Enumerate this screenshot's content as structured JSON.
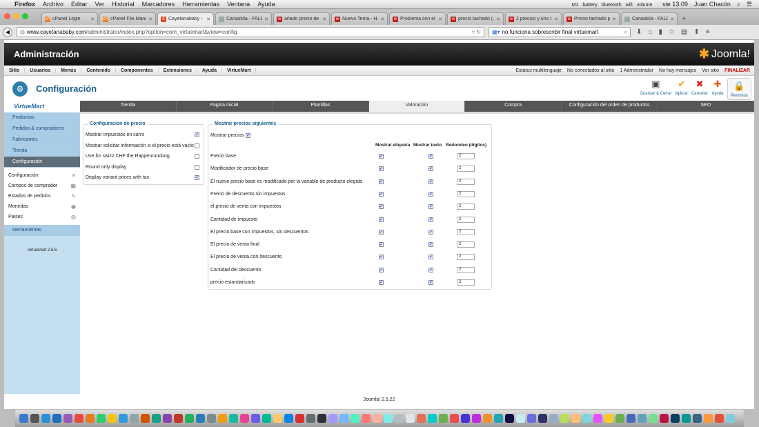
{
  "menubar": {
    "app": "Firefox",
    "items": [
      "Archivo",
      "Editar",
      "Ver",
      "Historial",
      "Marcadores",
      "Herramientas",
      "Ventana",
      "Ayuda"
    ],
    "clock": "vie 13:09",
    "user": "Juan Chacón",
    "status_icons": [
      "M1",
      "battery",
      "bluetooth",
      "wifi",
      "volume"
    ]
  },
  "tabs": [
    {
      "label": "cPanel Login",
      "favcolor": "#f08020",
      "fav": "cP",
      "active": false
    },
    {
      "label": "cPanel File Mana...",
      "favcolor": "#f08020",
      "fav": "cP",
      "active": false
    },
    {
      "label": "Cayetanababy - ...",
      "favcolor": "#e04a2a",
      "fav": "X",
      "active": true
    },
    {
      "label": "Canastilla - FALD...",
      "favcolor": "#9aa",
      "fav": "",
      "active": false
    },
    {
      "label": "añadir precio de ...",
      "favcolor": "#c21d1d",
      "fav": "w",
      "active": false
    },
    {
      "label": "Nuevo Tema - H...",
      "favcolor": "#c21d1d",
      "fav": "w",
      "active": false
    },
    {
      "label": "Problema con el ...",
      "favcolor": "#c21d1d",
      "fav": "w",
      "active": false
    },
    {
      "label": "precio tachado (...",
      "favcolor": "#c21d1d",
      "fav": "w",
      "active": false
    },
    {
      "label": "2 precios y uno t...",
      "favcolor": "#c21d1d",
      "fav": "w",
      "active": false
    },
    {
      "label": "Precio tachado p...",
      "favcolor": "#c21d1d",
      "fav": "w",
      "active": false
    },
    {
      "label": "Canastilla - FALD...",
      "favcolor": "#9aa",
      "fav": "",
      "active": false
    }
  ],
  "nav": {
    "url_host": "www.cayetanababy.com",
    "url_path": "/administrator/index.php?option=com_virtuemart&view=config",
    "search_value": "no funciona sobrescribir final virtuemart"
  },
  "admin": {
    "title": "Administración",
    "logo_text": "Joomla!",
    "menu": [
      "Sitio",
      "Usuarios",
      "Menús",
      "Contenido",
      "Componentes",
      "Extensiones",
      "Ayuda",
      "VirtueMart"
    ],
    "status": [
      "Estatus multilenguaje",
      "No conectados al sitio",
      "1 Administrador",
      "No hay mensajes",
      "Ver sitio",
      "FINALIZAR"
    ]
  },
  "toolbar": {
    "title": "Configuración",
    "buttons": [
      {
        "label": "Guardar & Cerrar",
        "icon": "save-icon",
        "glyph": "▣",
        "color": "#444"
      },
      {
        "label": "Aplicar",
        "icon": "check-icon",
        "glyph": "✔",
        "color": "#f39a18"
      },
      {
        "label": "Cancelar",
        "icon": "cancel-icon",
        "glyph": "✖",
        "color": "#d52b1e"
      },
      {
        "label": "Ayuda",
        "icon": "help-icon",
        "glyph": "✚",
        "color": "#e65a1a"
      },
      {
        "label": "Permisos",
        "icon": "lock-icon",
        "glyph": "🔒",
        "color": "#777"
      }
    ]
  },
  "sidebar": {
    "logo": "VirtueMart",
    "items": [
      {
        "label": "Productos",
        "selected": false
      },
      {
        "label": "Pedidos & compradores",
        "selected": false
      },
      {
        "label": "Fabricantes",
        "selected": false
      },
      {
        "label": "Tienda",
        "selected": false
      },
      {
        "label": "Configuración",
        "selected": true
      }
    ],
    "sub": [
      {
        "label": "Configuración",
        "icon": "✕"
      },
      {
        "label": "Campos de comprador",
        "icon": "▦"
      },
      {
        "label": "Estados de pedidos",
        "icon": "✎"
      },
      {
        "label": "Monedas",
        "icon": "◉"
      },
      {
        "label": "Paises",
        "icon": "◍"
      }
    ],
    "tools": "Herramientas",
    "version": "VirtueMart 2.6.6"
  },
  "vmtabs": [
    {
      "label": "Tienda",
      "selected": false
    },
    {
      "label": "Pagina inicial",
      "selected": false
    },
    {
      "label": "Plantillas",
      "selected": false
    },
    {
      "label": "Valoración",
      "selected": true
    },
    {
      "label": "Compra",
      "selected": false
    },
    {
      "label": "Configuración del orden de productos",
      "selected": false
    },
    {
      "label": "SEO",
      "selected": false
    }
  ],
  "price_config": {
    "legend": "Configuracion de precio",
    "rows": [
      {
        "label": "Mostrar impuestos en carro",
        "checked": true
      },
      {
        "label": "Mostrar solicitar información si el precio está vacío",
        "checked": false
      },
      {
        "label": "Use for swizz CHF the Rappenrundung",
        "checked": false
      },
      {
        "label": "Round only display",
        "checked": false
      },
      {
        "label": "Display variant prices with tax",
        "checked": true
      }
    ]
  },
  "show_prices": {
    "legend": "Mostrar precios siguientes",
    "show_label": "Mostrar precios",
    "show_checked": true,
    "col_label": "Mostrat etiqueta",
    "col_text": "Mostrar texto",
    "col_round": "Redondeo (dígitos)",
    "rows": [
      {
        "label": "Precio base",
        "label_on": true,
        "text_on": true,
        "round": "2"
      },
      {
        "label": "Modificador de precio base",
        "label_on": true,
        "text_on": true,
        "round": "2"
      },
      {
        "label": "El nuevo precio base es modificado por la variable de producto elegida",
        "label_on": true,
        "text_on": true,
        "round": "2"
      },
      {
        "label": "Precio de descuento sin impuestos",
        "label_on": true,
        "text_on": true,
        "round": "2"
      },
      {
        "label": "el precio de venta con impuestos",
        "label_on": true,
        "text_on": true,
        "round": "2"
      },
      {
        "label": "Cantidad de impuesto",
        "label_on": true,
        "text_on": true,
        "round": "2"
      },
      {
        "label": "El precio base con impuestos, sin descuentos",
        "label_on": true,
        "text_on": true,
        "round": "2"
      },
      {
        "label": "El precio de venta final",
        "label_on": true,
        "text_on": true,
        "round": "2"
      },
      {
        "label": "El precio de venta con descuento",
        "label_on": true,
        "text_on": true,
        "round": "2"
      },
      {
        "label": "Cantidad del descuento",
        "label_on": true,
        "text_on": true,
        "round": "2"
      },
      {
        "label": "precio estandarizado",
        "label_on": true,
        "text_on": true,
        "round": "2"
      }
    ]
  },
  "footer": "Joomla! 2.5.22"
}
